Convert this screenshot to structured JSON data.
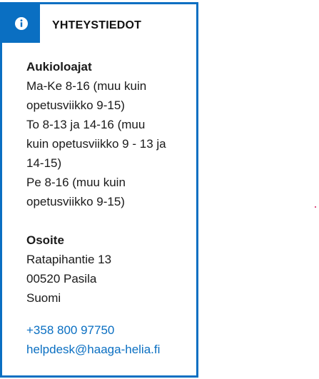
{
  "card": {
    "title": "YHTEYSTIEDOT",
    "icon": "info-icon",
    "accent_color": "#0a6fc2",
    "opening_hours": {
      "heading": "Aukioloajat",
      "lines": [
        "Ma-Ke 8-16 (muu kuin",
        "opetusviikko 9-15)",
        "To 8-13 ja 14-16 (muu",
        "kuin opetusviikko 9 - 13 ja",
        "14-15)",
        "Pe 8-16 (muu kuin",
        "opetusviikko 9-15)"
      ]
    },
    "address": {
      "heading": "Osoite",
      "lines": [
        "Ratapihantie 13",
        "00520 Pasila",
        "Suomi"
      ]
    },
    "contact": {
      "phone": "+358 800 97750",
      "email": "helpdesk@haaga-helia.fi"
    }
  }
}
